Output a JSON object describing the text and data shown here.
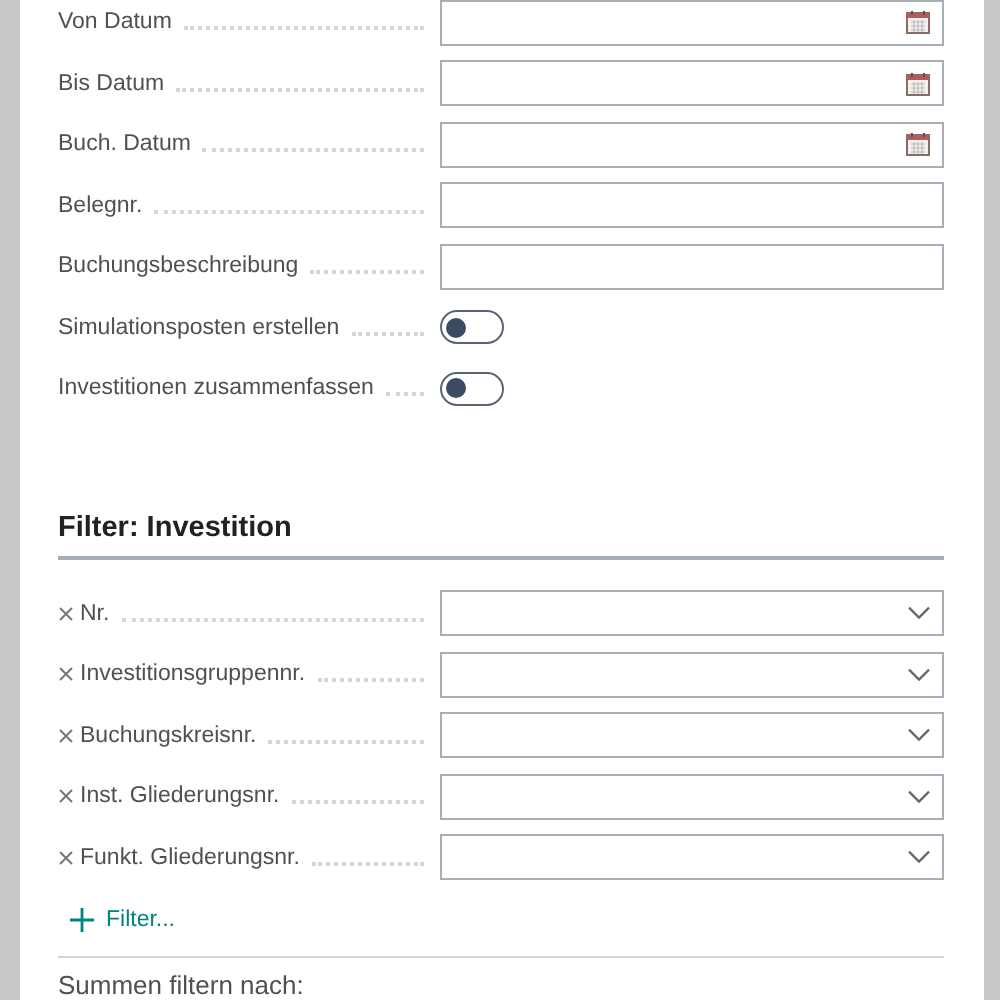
{
  "fields": [
    {
      "label": "Von Datum",
      "kind": "date"
    },
    {
      "label": "Bis Datum",
      "kind": "date"
    },
    {
      "label": "Buch. Datum",
      "kind": "date"
    },
    {
      "label": "Belegnr.",
      "kind": "text"
    },
    {
      "label": "Buchungsbeschreibung",
      "kind": "text"
    },
    {
      "label": "Simulationsposten erstellen",
      "kind": "toggle",
      "on": false
    },
    {
      "label": "Investitionen zusammenfassen",
      "kind": "toggle",
      "on": false
    }
  ],
  "filter_section": {
    "title": "Filter: Investition",
    "filters": [
      {
        "label": "Nr."
      },
      {
        "label": "Investitionsgruppennr."
      },
      {
        "label": "Buchungskreisnr."
      },
      {
        "label": "Inst. Gliederungsnr."
      },
      {
        "label": "Funkt. Gliederungsnr."
      }
    ],
    "add_filter": "Filter..."
  },
  "totals_section": {
    "title": "Summen filtern nach:"
  }
}
